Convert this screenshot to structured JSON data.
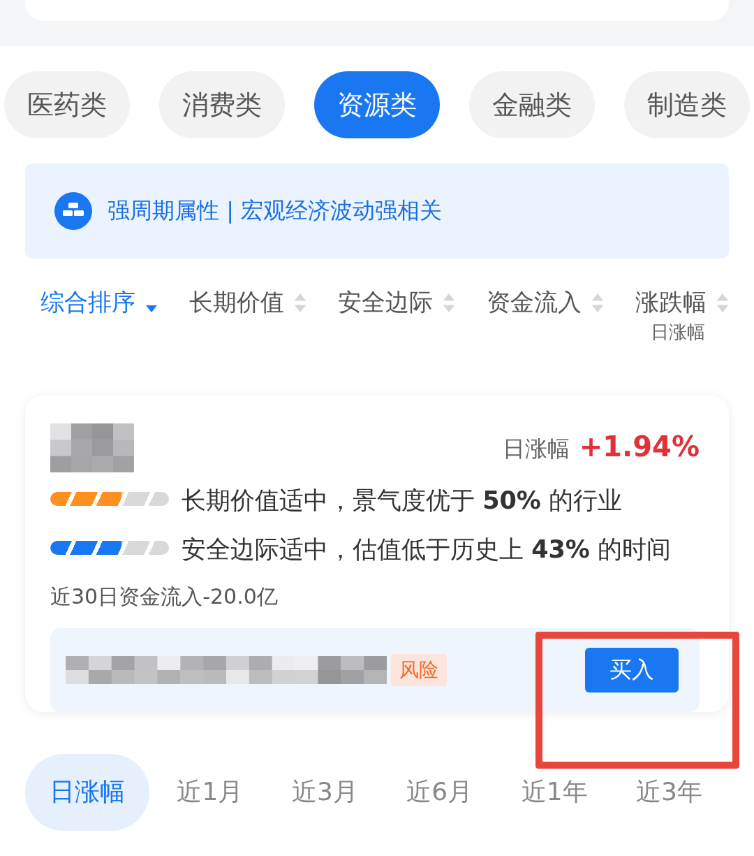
{
  "tabs": [
    {
      "label": "医药类",
      "selected": false
    },
    {
      "label": "消费类",
      "selected": false
    },
    {
      "label": "资源类",
      "selected": true
    },
    {
      "label": "金融类",
      "selected": false
    },
    {
      "label": "制造类",
      "selected": false
    }
  ],
  "banner": {
    "text": "强周期属性 | 宏观经济波动强相关"
  },
  "sort_options": [
    {
      "label": "综合排序",
      "selected": true
    },
    {
      "label": "长期价值",
      "selected": false
    },
    {
      "label": "安全边际",
      "selected": false
    },
    {
      "label": "资金流入",
      "selected": false
    },
    {
      "label": "涨跌幅",
      "selected": false,
      "sublabel": "日涨幅"
    }
  ],
  "card": {
    "change_label": "日涨幅",
    "change": "+1.94%",
    "metrics": [
      {
        "text": "长期价值适中，景气度优于 **50%** 的行业",
        "level": 0.6,
        "color": "#ff8f1f"
      },
      {
        "text": "安全边际适中，估值低于历史上 **43%** 的时间",
        "level": 0.6,
        "color": "#1a77f2"
      }
    ],
    "fund_flow": "近30日资金流入-20.0亿",
    "tag": "风险",
    "button": "买入"
  },
  "periods": [
    {
      "label": "日涨幅",
      "selected": true
    },
    {
      "label": "近1月",
      "selected": false
    },
    {
      "label": "近3月",
      "selected": false
    },
    {
      "label": "近6月",
      "selected": false
    },
    {
      "label": "近1年",
      "selected": false
    },
    {
      "label": "近3年",
      "selected": false
    }
  ]
}
